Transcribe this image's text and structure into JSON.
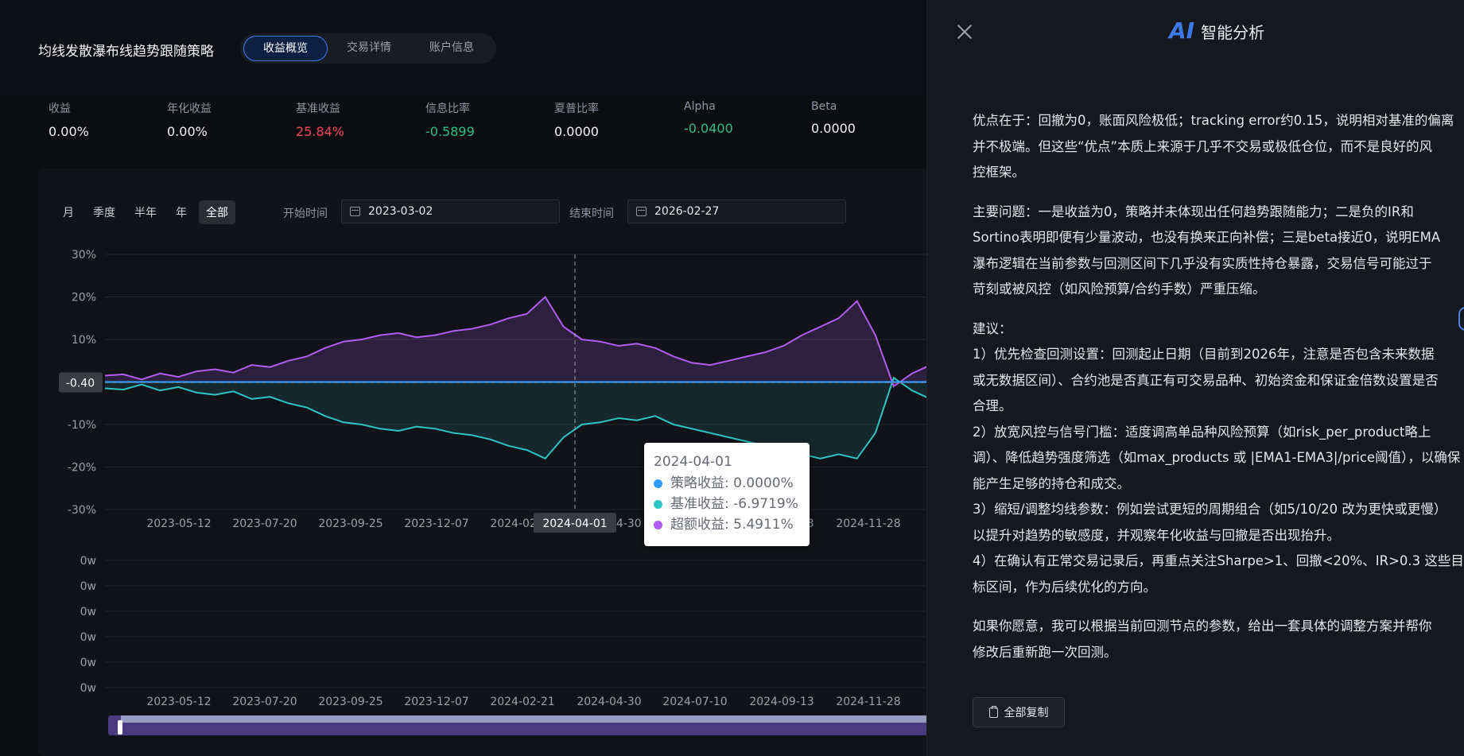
{
  "header": {
    "strategy_title": "均线发散瀑布线趋势跟随策略",
    "tabs": [
      "收益概览",
      "交易详情",
      "账户信息"
    ]
  },
  "metrics": [
    {
      "label": "收益",
      "value": "0.00%",
      "color": "#f3f4f7"
    },
    {
      "label": "年化收益",
      "value": "0.00%",
      "color": "#f3f4f7"
    },
    {
      "label": "基准收益",
      "value": "25.84%",
      "color": "#f0485a"
    },
    {
      "label": "信息比率",
      "value": "-0.5899",
      "color": "#2fbf84"
    },
    {
      "label": "夏普比率",
      "value": "0.0000",
      "color": "#f3f4f7"
    },
    {
      "label": "Alpha",
      "value": "-0.0400",
      "color": "#2fbf84"
    },
    {
      "label": "Beta",
      "value": "0.0000",
      "color": "#f3f4f7"
    }
  ],
  "controls": {
    "ranges": [
      "月",
      "季度",
      "半年",
      "年",
      "全部"
    ],
    "active_range": "全部",
    "start_label": "开始时间",
    "start_date": "2023-03-02",
    "end_label": "结束时间",
    "end_date": "2026-02-27"
  },
  "chart_data": [
    {
      "type": "line",
      "y_ticks": [
        "30%",
        "20%",
        "10%",
        "-10%",
        "-20%",
        "-30%"
      ],
      "ylim": [
        -30,
        30
      ],
      "x_ticks": [
        "2023-05-12",
        "2023-07-20",
        "2023-09-25",
        "2023-12-07",
        "2024-02-21",
        "2024-04-30",
        "2024-07-10",
        "2024-09-13",
        "2024-11-28"
      ],
      "y_pointer_label": "-0.40",
      "x_pointer_label": "2024-04-01",
      "series": [
        {
          "name": "策略收益",
          "color": "#2e9bff",
          "values": [
            0,
            0,
            0,
            0,
            0,
            0,
            0,
            0,
            0,
            0,
            0,
            0,
            0,
            0,
            0,
            0,
            0,
            0,
            0,
            0,
            0,
            0,
            0,
            0,
            0,
            0,
            0,
            0,
            0,
            0,
            0,
            0,
            0,
            0,
            0,
            0,
            0,
            0,
            0,
            0,
            0,
            0,
            0,
            0,
            0,
            0
          ]
        },
        {
          "name": "基准收益",
          "color": "#2ec4c4",
          "values": [
            -1.5,
            -1.8,
            -0.6,
            -2,
            -1.2,
            -2.5,
            -3,
            -2.2,
            -4,
            -3.5,
            -5,
            -6,
            -8,
            -9.5,
            -10,
            -11,
            -11.5,
            -10.5,
            -11,
            -12,
            -12.5,
            -13.5,
            -15,
            -16,
            -18,
            -13,
            -10,
            -9.5,
            -8.5,
            -9,
            -8,
            -10,
            -11,
            -12,
            -13,
            -14,
            -15,
            -16,
            -17,
            -18,
            -17,
            -18,
            -12,
            1,
            -2,
            -4
          ]
        },
        {
          "name": "超额收益",
          "color": "#b05cf0",
          "values": [
            1.5,
            1.8,
            0.6,
            2,
            1.2,
            2.5,
            3,
            2.2,
            4,
            3.5,
            5,
            6,
            8,
            9.5,
            10,
            11,
            11.5,
            10.5,
            11,
            12,
            12.5,
            13.5,
            15,
            16,
            20,
            13,
            10,
            9.5,
            8.5,
            9,
            8,
            6,
            4.5,
            4,
            5,
            6,
            7,
            8.5,
            11,
            13,
            15,
            19,
            11,
            -1,
            2,
            4
          ]
        }
      ],
      "tooltip": {
        "date": "2024-04-01",
        "rows": [
          {
            "label": "策略收益: 0.0000%",
            "color": "#2e9bff"
          },
          {
            "label": "基准收益: -6.9719%",
            "color": "#2ec4c4"
          },
          {
            "label": "超额收益: 5.4911%",
            "color": "#b05cf0"
          }
        ]
      }
    },
    {
      "type": "bar",
      "y_ticks": [
        "0w",
        "0w",
        "0w",
        "0w",
        "0w",
        "0w"
      ],
      "x_ticks": [
        "2023-05-12",
        "2023-07-20",
        "2023-09-25",
        "2023-12-07",
        "2024-02-21",
        "2024-04-30",
        "2024-07-10",
        "2024-09-13",
        "2024-11-28"
      ],
      "values": []
    }
  ],
  "ai_panel": {
    "logo": "AI",
    "title": "智能分析",
    "paragraphs": [
      [
        "优点在于：回撤为0，账面风险极低；tracking error约0.15，说明相对基准的偏离",
        "并不极端。但这些“优点”本质上来源于几乎不交易或极低仓位，而不是良好的风",
        "控框架。"
      ],
      [
        "主要问题：一是收益为0，策略并未体现出任何趋势跟随能力；二是负的IR和",
        "Sortino表明即便有少量波动，也没有换来正向补偿；三是beta接近0，说明EMA",
        "瀑布逻辑在当前参数与回测区间下几乎没有实质性持仓暴露，交易信号可能过于",
        "苛刻或被风控（如风险预算/合约手数）严重压缩。"
      ],
      [
        "建议：",
        "1）优先检查回测设置：回测起止日期（目前到2026年，注意是否包含未来数据",
        "或无数据区间）、合约池是否真正有可交易品种、初始资金和保证金倍数设置是否",
        "合理。",
        "2）放宽风控与信号门槛：适度调高单品种风险预算（如risk_per_product略上",
        "调）、降低趋势强度筛选（如max_products 或 |EMA1-EMA3|/price阈值），以确保",
        "能产生足够的持仓和成交。",
        "3）缩短/调整均线参数：例如尝试更短的周期组合（如5/10/20 改为更快或更慢）",
        "以提升对趋势的敏感度，并观察年化收益与回撤是否出现抬升。",
        "4）在确认有正常交易记录后，再重点关注Sharpe>1、回撤<20%、IR>0.3 这些目",
        "标区间，作为后续优化的方向。"
      ],
      [
        "如果你愿意，我可以根据当前回测节点的参数，给出一套具体的调整方案并帮你",
        "修改后重新跑一次回测。"
      ]
    ],
    "copy_label": "全部复制"
  }
}
